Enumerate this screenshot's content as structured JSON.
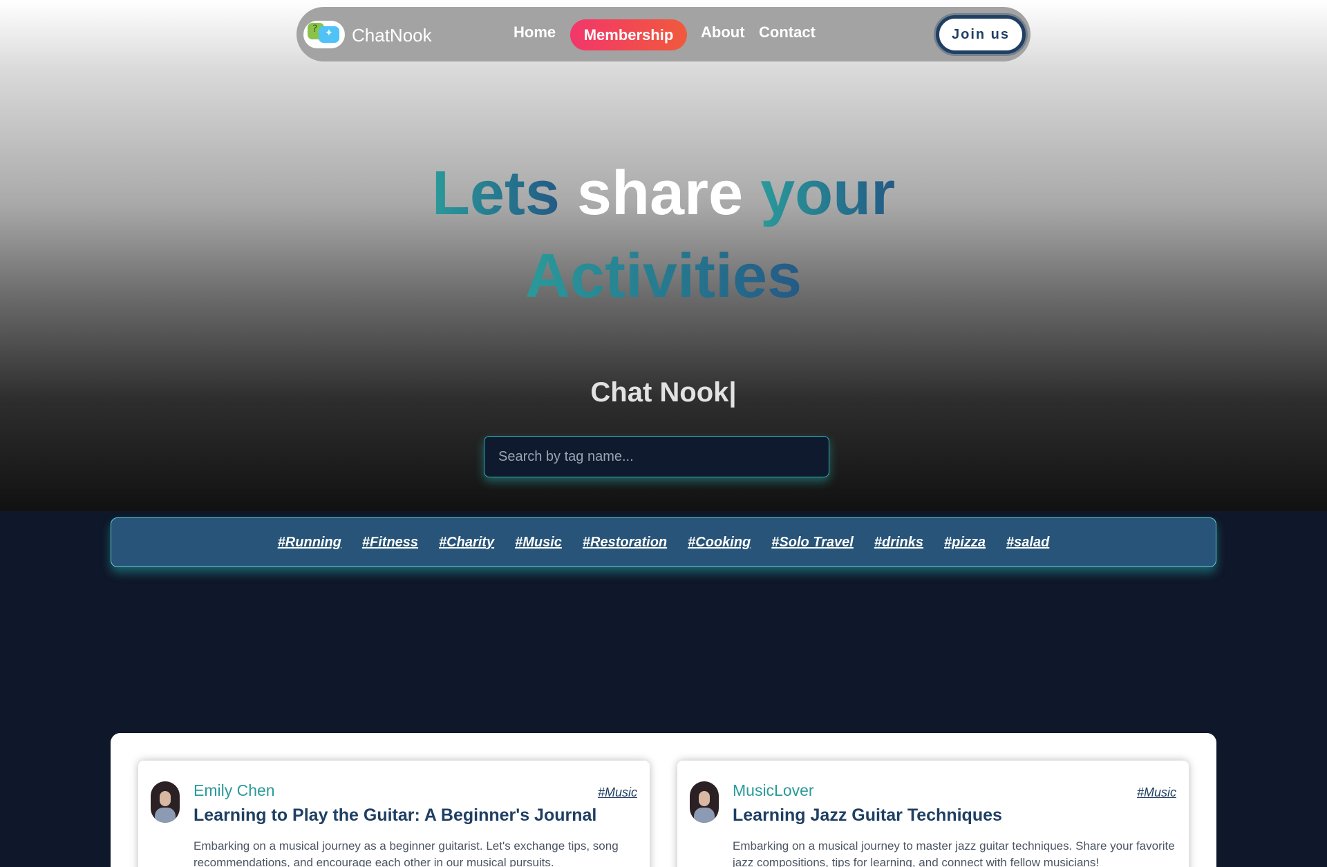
{
  "nav": {
    "brand": "ChatNook",
    "links": {
      "home": "Home",
      "membership": "Membership",
      "about": "About",
      "contact": "Contact"
    },
    "join": "Join us"
  },
  "hero": {
    "headline": {
      "w1": "Lets",
      "w2": "share",
      "w3": "your",
      "w4": "Activities"
    },
    "typing": "Chat Nook|",
    "search_placeholder": "Search by tag name..."
  },
  "tags": [
    "#Running",
    "#Fitness",
    "#Charity",
    "#Music",
    "#Restoration",
    "#Cooking",
    "#Solo Travel",
    "#drinks",
    "#pizza",
    "#salad"
  ],
  "posts": [
    {
      "author": "Emily Chen",
      "title": "Learning to Play the Guitar: A Beginner's Journal",
      "tag": "#Music",
      "description": "Embarking on a musical journey as a beginner guitarist. Let's exchange tips, song recommendations, and encourage each other in our musical pursuits."
    },
    {
      "author": "MusicLover",
      "title": "Learning Jazz Guitar Techniques",
      "tag": "#Music",
      "description": "Embarking on a musical journey to master jazz guitar techniques. Share your favorite jazz compositions, tips for learning, and connect with fellow musicians!"
    }
  ],
  "colors": {
    "accent_teal": "#2a9a9a",
    "accent_navy": "#1f3f63",
    "membership_pink": "#f2366b",
    "tagbar_bg": "#275478",
    "page_bg": "#0f172a"
  }
}
